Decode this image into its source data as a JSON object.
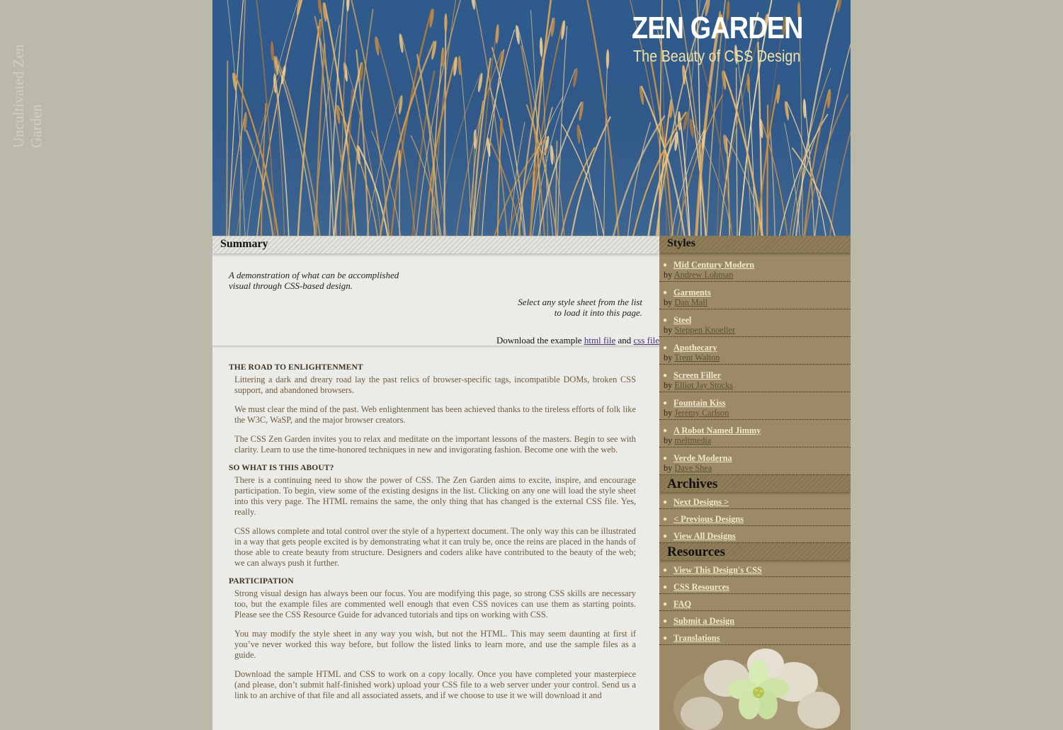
{
  "side_title": "Uncultivated Zen Garden",
  "header": {
    "title": "ZEN GARDEN",
    "subtitle": "The Beauty of CSS Design"
  },
  "summary": {
    "heading": "Summary",
    "tagline_1": "A demonstration of what can be accomplished",
    "tagline_2": "visual through CSS-based design.",
    "select_1": "Select any style sheet from the list",
    "select_2": "to load it into this page.",
    "download_prefix": "Download the example ",
    "html_file": "html file",
    "and": " and ",
    "css_file": "css file"
  },
  "sections": [
    {
      "heading": "THE ROAD TO ENLIGHTENMENT",
      "paragraphs": [
        "Littering a dark and dreary road lay the past relics of browser-specific tags, incompatible DOMs, broken CSS support, and abandoned browsers.",
        "We must clear the mind of the past. Web enlightenment has been achieved thanks to the tireless efforts of folk like the W3C, WaSP, and the major browser creators.",
        "The CSS Zen Garden invites you to relax and meditate on the important lessons of the masters. Begin to see with clarity. Learn to use the time-honored techniques in new and invigorating fashion. Become one with the web."
      ]
    },
    {
      "heading": "SO WHAT IS THIS ABOUT?",
      "paragraphs": [
        "There is a continuing need to show the power of CSS. The Zen Garden aims to excite, inspire, and encourage participation. To begin, view some of the existing designs in the list. Clicking on any one will load the style sheet into this very page. The HTML remains the same, the only thing that has changed is the external CSS file. Yes, really.",
        "CSS allows complete and total control over the style of a hypertext document. The only way this can be illustrated in a way that gets people excited is by demonstrating what it can truly be, once the reins are placed in the hands of those able to create beauty from structure. Designers and coders alike have contributed to the beauty of the web; we can always push it further."
      ]
    },
    {
      "heading": "PARTICIPATION",
      "paragraphs": [
        "Strong visual design has always been our focus. You are modifying this page, so strong CSS skills are necessary too, but the example files are commented well enough that even CSS novices can use them as starting points. Please see the CSS Resource Guide for advanced tutorials and tips on working with CSS.",
        "You may modify the style sheet in any way you wish, but not the HTML. This may seem daunting at first if you’ve never worked this way before, but follow the listed links to learn more, and use the sample files as a guide.",
        "Download the sample HTML and CSS to work on a copy locally. Once you have completed your masterpiece (and please, don’t submit half-finished work) upload your CSS file to a web server under your control. Send us a link to an archive of that file and all associated assets, and if we choose to use it we will download it and"
      ]
    }
  ],
  "sidebar": {
    "styles_heading": "Styles",
    "by": "by ",
    "styles": [
      {
        "name": "Mid Century Modern",
        "author": "Andrew Lohman"
      },
      {
        "name": "Garments",
        "author": "Dan Mall"
      },
      {
        "name": "Steel",
        "author": "Steppen Knoeller"
      },
      {
        "name": "Apothecary",
        "author": "Trent Walton"
      },
      {
        "name": "Screen Filler",
        "author": "Elliot Jay Stocks"
      },
      {
        "name": "Fountain Kiss",
        "author": "Jeremy Carlson"
      },
      {
        "name": "A Robot Named Jimmy",
        "author": "meltmedia"
      },
      {
        "name": "Verde Moderna",
        "author": "Dave Shea"
      }
    ],
    "archives_heading": "Archives",
    "archives": [
      "Next Designs >",
      "< Previous Designs",
      "View All Designs"
    ],
    "resources_heading": "Resources",
    "resources": [
      "View This Design's CSS",
      "CSS Resources",
      "FAQ",
      "Submit a Design",
      "Translations"
    ]
  },
  "colors": {
    "page_bg": "#bbb9aa",
    "main_bg": "#ebebe8",
    "sidebar_bg": "#9c8a66",
    "body_text": "#6d5b3e",
    "sidebar_link": "#f1e8cc",
    "header_subtitle": "#efe1a6"
  }
}
